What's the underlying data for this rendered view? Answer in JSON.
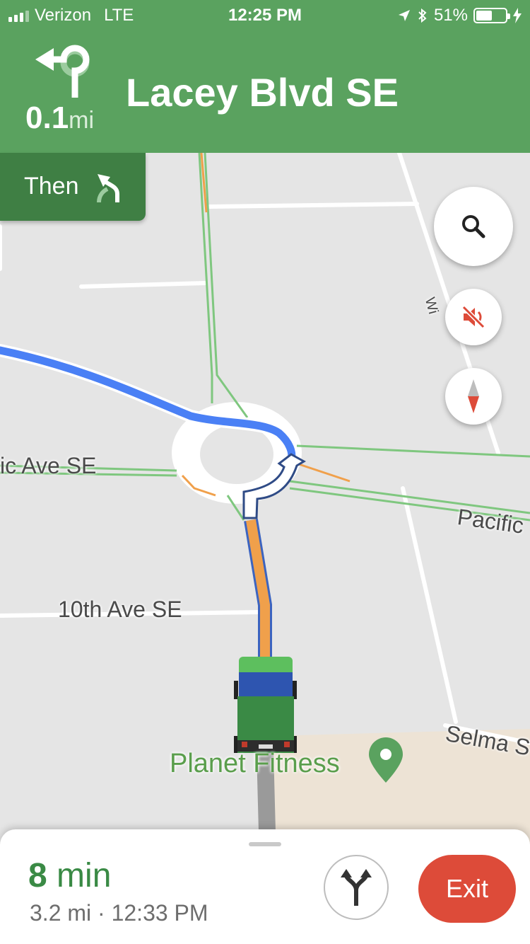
{
  "status_bar": {
    "carrier": "Verizon",
    "network": "LTE",
    "time": "12:25 PM",
    "battery": "51%"
  },
  "nav_header": {
    "distance_value": "0.1",
    "distance_unit": "mi",
    "street": "Lacey Blvd SE",
    "maneuver_icon": "u-turn-left-icon"
  },
  "then_box": {
    "label": "Then",
    "icon": "slight-left-icon"
  },
  "map": {
    "labels": {
      "west_street": "ic Ave SE",
      "east_street": "Pacific",
      "tenth_ave": "10th Ave SE",
      "selma": "Selma S",
      "wi_fragment": "Wi",
      "poi": "Planet Fitness"
    },
    "colors": {
      "route_blue": "#4a80f5",
      "route_traffic": "#f0a04b",
      "road_green": "#7fc77f",
      "header_green": "#5aa25f"
    }
  },
  "controls": {
    "search_icon": "search-icon",
    "mute_icon": "volume-off-icon",
    "compass_icon": "compass-icon"
  },
  "bottom_sheet": {
    "duration_value": "8",
    "duration_unit": " min",
    "distance": "3.2 mi",
    "separator": " · ",
    "arrival": "12:33 PM",
    "routes_icon": "alternate-routes-icon",
    "exit_label": "Exit"
  }
}
